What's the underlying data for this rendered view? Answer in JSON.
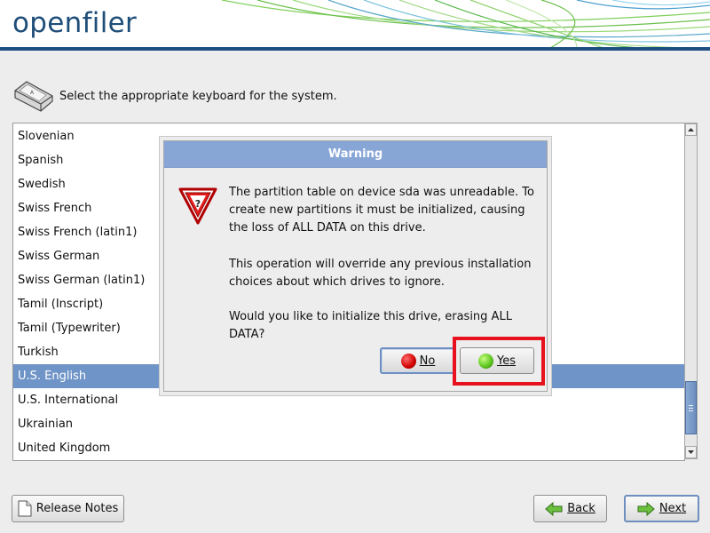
{
  "header": {
    "logo_text": "openfiler"
  },
  "prompt": {
    "text": "Select the appropriate keyboard for the system.",
    "icon": "keyboard-icon"
  },
  "keyboard_list": {
    "items": [
      "Slovenian",
      "Spanish",
      "Swedish",
      "Swiss French",
      "Swiss French (latin1)",
      "Swiss German",
      "Swiss German (latin1)",
      "Tamil (Inscript)",
      "Tamil (Typewriter)",
      "Turkish",
      "U.S. English",
      "U.S. International",
      "Ukrainian",
      "United Kingdom"
    ],
    "selected": "U.S. English"
  },
  "dialog": {
    "title": "Warning",
    "icon": "warning-icon",
    "message_1": "The partition table on device sda was unreadable. To create new partitions it must be initialized, causing the loss of ALL DATA on this drive.",
    "message_2": "This operation will override any previous installation choices about which drives to ignore.",
    "message_3": "Would you like to initialize this drive, erasing ALL DATA?",
    "no_label": "No",
    "yes_label": "Yes"
  },
  "buttons": {
    "release_notes": "Release Notes",
    "back": "Back",
    "next": "Next"
  },
  "colors": {
    "header_rule": "#1d4f80",
    "selection": "#6f94c7",
    "dialog_title": "#87a6d6",
    "highlight": "#e8121e"
  }
}
